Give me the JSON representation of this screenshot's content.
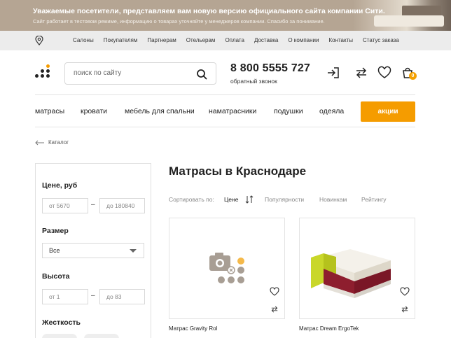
{
  "banner": {
    "title": "Уважаемые посетители, представляем вам новую версию официального сайта компании Сити.",
    "subtitle": "Сайт работает в тестовом режиме, информацию о товарах уточняйте у менеджеров компании. Спасибо за понимание."
  },
  "topnav": {
    "links": [
      "Салоны",
      "Покупателям",
      "Партнерам",
      "Отельерам",
      "Оплата",
      "Доставка",
      "О компании",
      "Контакты",
      "Статус заказа"
    ]
  },
  "header": {
    "search_placeholder": "поиск по сайту",
    "phone": "8 800 5555 727",
    "callback": "обратный звонок",
    "cart_count": "0"
  },
  "catnav": {
    "items": [
      "матрасы",
      "кровати",
      "мебель для спальни",
      "наматрасники",
      "подушки",
      "одеяла"
    ],
    "sale": "акции"
  },
  "breadcrumb": {
    "label": "Каталог"
  },
  "filters": {
    "price_title": "Цене, руб",
    "price_from": "от 5670",
    "price_to": "до 180840",
    "dash": "–",
    "size_title": "Размер",
    "size_value": "Все",
    "height_title": "Высота",
    "height_from": "от 1",
    "height_to": "до 83",
    "hardness_title": "Жесткость"
  },
  "main": {
    "title": "Матрасы в Краснодаре",
    "sort_label": "Сортировать по:",
    "sort_options": [
      "Цене",
      "Популярности",
      "Новинкам",
      "Рейтингу"
    ]
  },
  "products": [
    {
      "name": "Матрас Gravity Rol"
    },
    {
      "name": "Матрас Dream ErgoTek"
    }
  ],
  "colors": {
    "accent": "#f59c00",
    "banner": "#b5a593",
    "topnav": "#ececec"
  }
}
